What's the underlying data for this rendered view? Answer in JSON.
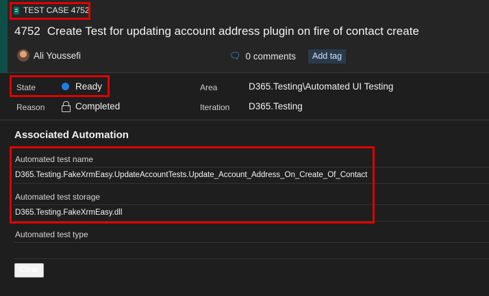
{
  "work_item": {
    "type_label": "TEST CASE 4752",
    "id": "4752",
    "title": "Create Test for updating account address plugin on fire of contact create",
    "author": "Ali Youssefi",
    "comments": "0 comments",
    "add_tag": "Add tag"
  },
  "fields": {
    "state_label": "State",
    "state_value": "Ready",
    "reason_label": "Reason",
    "reason_value": "Completed",
    "area_label": "Area",
    "area_value": "D365.Testing\\Automated UI Testing",
    "iteration_label": "Iteration",
    "iteration_value": "D365.Testing"
  },
  "automation": {
    "section_title": "Associated Automation",
    "test_name_label": "Automated test name",
    "test_name_value": "D365.Testing.FakeXrmEasy.UpdateAccountTests.Update_Account_Address_On_Create_Of_Contact",
    "test_storage_label": "Automated test storage",
    "test_storage_value": "D365.Testing.FakeXrmEasy.dll",
    "test_type_label": "Automated test type",
    "test_type_value": "",
    "clear_label": "Clear"
  },
  "colors": {
    "accent": "#1f7ee5",
    "highlight": "#e00000",
    "background": "#1e1e1e"
  }
}
